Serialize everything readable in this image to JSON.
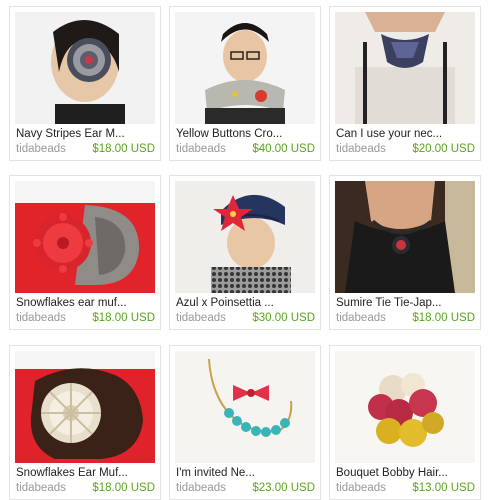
{
  "listings": [
    {
      "title": "Navy Stripes Ear M...",
      "shop": "tidabeads",
      "price": "$18.00 USD",
      "image": "ear-muff-navy-stripes-photo"
    },
    {
      "title": "Yellow Buttons Cro...",
      "shop": "tidabeads",
      "price": "$40.00 USD",
      "image": "crochet-scarf-yellow-buttons-photo"
    },
    {
      "title": "Can I use your nec...",
      "shop": "tidabeads",
      "price": "$20.00 USD",
      "image": "neck-tie-collar-photo"
    },
    {
      "title": "Snowflakes ear muf...",
      "shop": "tidabeads",
      "price": "$18.00 USD",
      "image": "snowflake-ear-muff-red-photo"
    },
    {
      "title": "Azul x Poinsettia ...",
      "shop": "tidabeads",
      "price": "$30.00 USD",
      "image": "poinsettia-hat-photo"
    },
    {
      "title": "Sumire Tie Tie-Jap...",
      "shop": "tidabeads",
      "price": "$18.00 USD",
      "image": "tie-necklace-photo"
    },
    {
      "title": "Snowflakes Ear Muf...",
      "shop": "tidabeads",
      "price": "$18.00 USD",
      "image": "snowflake-ear-muff-white-photo"
    },
    {
      "title": "I'm invited Ne...",
      "shop": "tidabeads",
      "price": "$23.00 USD",
      "image": "bow-necklace-photo"
    },
    {
      "title": "Bouquet Bobby Hair...",
      "shop": "tidabeads",
      "price": "$13.00 USD",
      "image": "crochet-flower-hair-pin-photo"
    }
  ],
  "colors": {
    "price": "#5aa51f",
    "shop": "#999999",
    "title": "#222222",
    "card_border": "#e3e3e3"
  }
}
